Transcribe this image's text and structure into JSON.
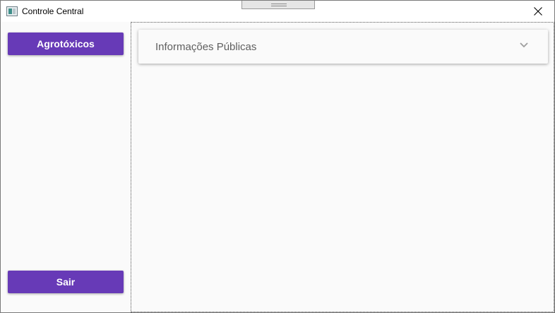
{
  "window": {
    "title": "Controle Central"
  },
  "sidebar": {
    "agrotoxicos_label": "Agrotóxicos",
    "sair_label": "Sair"
  },
  "content": {
    "expander_title": "Informações Públicas",
    "expanded": false
  },
  "colors": {
    "accent": "#673ab7",
    "background": "#fafafa",
    "title_text": "#5f5f5f"
  },
  "icons": {
    "app": "window-app-icon",
    "close": "close-icon",
    "expander": "chevron-down-icon"
  }
}
